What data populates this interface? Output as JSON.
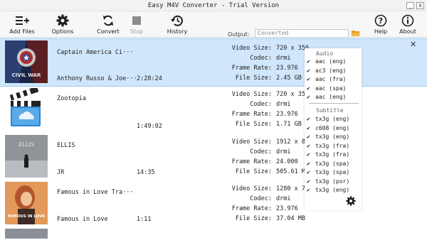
{
  "window": {
    "title": "Easy M4V Converter - Trial Version",
    "minimize": "_",
    "close": "x"
  },
  "toolbar": {
    "add_files": "Add Files",
    "options": "Options",
    "convert": "Convert",
    "stop": "Stop",
    "history": "History",
    "output_label": "Output:",
    "output_placeholder": "Converted",
    "help": "Help",
    "about": "About"
  },
  "items": [
    {
      "title": "Captain America  Ci···",
      "subtitle": "Anthony Russo & Joe···",
      "duration": "2:28:24",
      "video_size": "720 x 356",
      "codec": "drmi",
      "frame_rate": "23.976",
      "file_size": "2.45 GB",
      "selected": true
    },
    {
      "title": "Zootopia",
      "subtitle": "",
      "duration": "1:49:02",
      "video_size": "720 x 356",
      "codec": "drmi",
      "frame_rate": "23.976",
      "file_size": "1.71 GB"
    },
    {
      "title": "ELLIS",
      "subtitle": "JR",
      "duration": "14:35",
      "video_size": "1912 x 800",
      "codec": "drmi",
      "frame_rate": "24.000",
      "file_size": "505.61 MB"
    },
    {
      "title": "Famous in Love  Tra···",
      "subtitle": "Famous in Love",
      "duration": "1:11",
      "video_size": "1280 x 718",
      "codec": "drmi",
      "frame_rate": "23.976",
      "file_size": "37.04 MB"
    }
  ],
  "labels": {
    "video_size": "Video Size:",
    "codec": "Codec:",
    "frame_rate": "Frame Rate:",
    "file_size": "File Size:"
  },
  "thumb_text": {
    "civil_war": "CIVIL WAR",
    "ellis": "ELLIS",
    "famous": "FAMOUS IN LOVE"
  },
  "popup": {
    "audio_header": "Audio",
    "audio": [
      {
        "label": "aac (eng)",
        "checked": true
      },
      {
        "label": "ac3 (eng)",
        "checked": true
      },
      {
        "label": "aac (fra)",
        "checked": true
      },
      {
        "label": "aac (spa)",
        "checked": true
      },
      {
        "label": "aac (eng)",
        "checked": true
      }
    ],
    "subtitle_header": "Subtitle",
    "subtitles": [
      {
        "label": "tx3g (eng)",
        "checked": true
      },
      {
        "label": "c608 (eng)",
        "checked": true
      },
      {
        "label": "tx3g (eng)",
        "checked": true
      },
      {
        "label": "tx3g (fra)",
        "checked": true
      },
      {
        "label": "tx3g (fra)",
        "checked": true
      },
      {
        "label": "tx3g (spa)",
        "checked": true
      },
      {
        "label": "tx3g (spa)",
        "checked": true
      },
      {
        "label": "tx3g (por)",
        "checked": true
      },
      {
        "label": "tx3g (eng)",
        "checked": true
      }
    ]
  },
  "colors": {
    "selected_row": "#cfe6fb",
    "toolbar_bg": "#f7f7f7",
    "icon": "#1e1e1e"
  }
}
